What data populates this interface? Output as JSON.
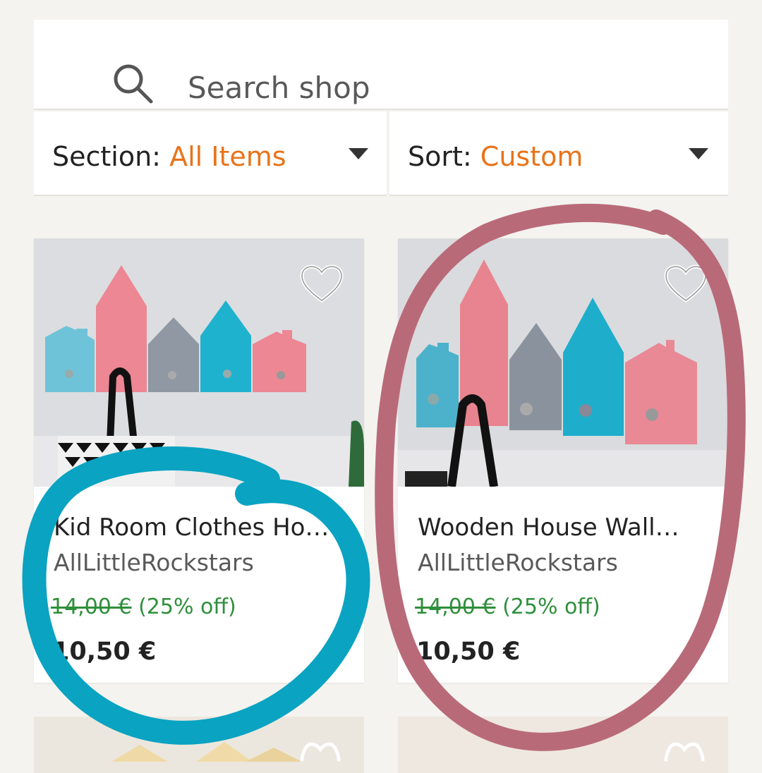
{
  "search": {
    "placeholder": "Search shop"
  },
  "filters": {
    "section_label": "Section: ",
    "section_value": "All Items",
    "sort_label": "Sort: ",
    "sort_value": "Custom"
  },
  "listings": [
    {
      "title": "Kid Room Clothes Ho…",
      "shop": "AllLittleRockstars",
      "original_price": "14,00 €",
      "discount": "(25% off)",
      "price": "10,50 €"
    },
    {
      "title": "Wooden House Wall…",
      "shop": "AllLittleRockstars",
      "original_price": "14,00 €",
      "discount": "(25% off)",
      "price": "10,50 €"
    }
  ],
  "colors": {
    "accent": "#e8731a",
    "sale_green": "#2f8f3b",
    "annotation_blue": "#0aa3c2",
    "annotation_pink": "#b96a78"
  }
}
